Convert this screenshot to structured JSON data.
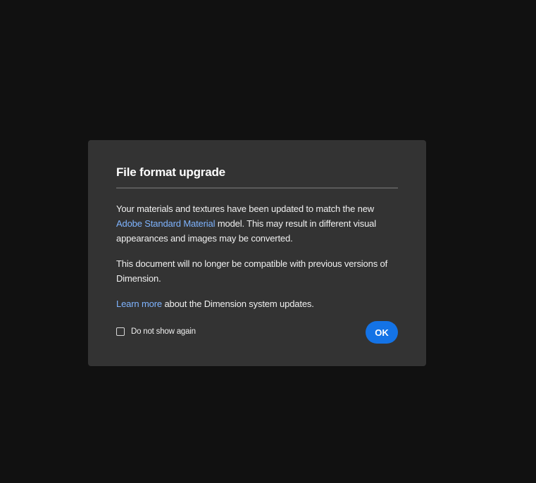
{
  "dialog": {
    "title": "File format upgrade",
    "paragraph1": {
      "before": "Your materials and textures have been updated to match the new ",
      "link": "Adobe Standard Material",
      "after": " model. This may result in different visual appearances and images may be converted."
    },
    "paragraph2": "This document will no longer be compatible with previous versions of Dimension.",
    "paragraph3": {
      "link": "Learn more",
      "after": " about the Dimension system updates."
    },
    "checkbox_label": "Do not show again",
    "checkbox_checked": false,
    "ok_label": "OK"
  },
  "colors": {
    "backdrop": "#111111",
    "dialog_bg": "#333333",
    "link": "#7fb4ff",
    "primary_button": "#1473e6"
  }
}
